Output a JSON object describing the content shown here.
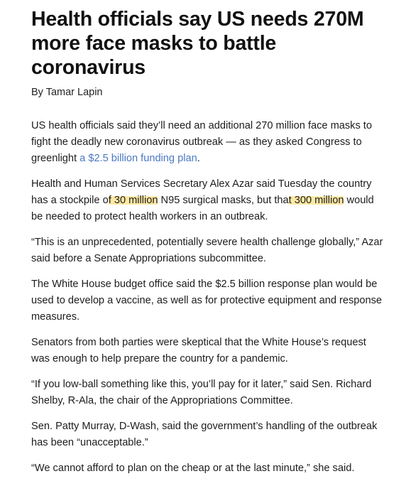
{
  "article": {
    "headline": "Health officials say US needs 270M more face masks to battle coronavirus",
    "byline": "By Tamar Lapin",
    "paragraphs": [
      {
        "before": "US health officials said they’ll need an additional 270 million face masks to fight the deadly new coronavirus outbreak — as they asked Congress to greenlight ",
        "link": "a $2.5 billion funding plan",
        "after": "."
      },
      {
        "p1": "Health and Human Services Secretary Alex Azar said Tuesday the country has a stockpile o",
        "hl1": "f 30 million",
        "p2": " N95 surgical masks, but tha",
        "hl2": "t 300 million",
        "p3": " would be needed to protect health workers in an outbreak."
      },
      "“This is an unprecedented, potentially severe health challenge globally,” Azar said before a Senate Appropriations subcommittee.",
      "The White House budget office said the $2.5 billion response plan would be used to develop a vaccine, as well as for protective equipment and response measures.",
      "Senators from both parties were skeptical that the White House’s request was enough to help prepare the country for a pandemic.",
      "“If you low-ball something like this, you’ll pay for it later,” said Sen. Richard Shelby, R-Ala, the chair of the Appropriations Committee.",
      "Sen. Patty Murray, D-Wash, said the government’s handling of the outbreak has been “unacceptable.”",
      "“We cannot afford to plan on the cheap or at the last minute,” she said."
    ]
  },
  "colors": {
    "link": "#4a78c2",
    "highlight": "#fde9a6",
    "text": "#1c1c1c"
  }
}
